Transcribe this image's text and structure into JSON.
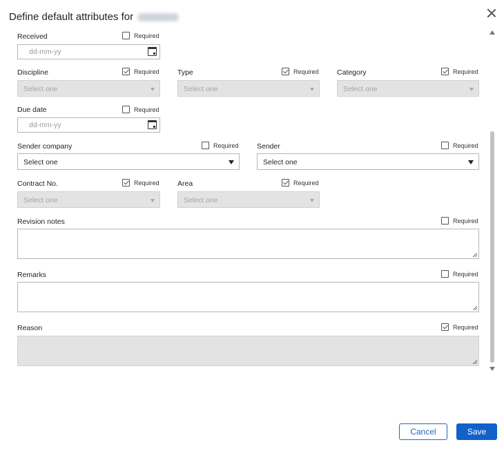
{
  "dialog": {
    "title": "Define default attributes for",
    "close_icon": "close-icon"
  },
  "required_label": "Required",
  "fields": {
    "received": {
      "label": "Received",
      "placeholder": "dd-mm-yy",
      "required": false
    },
    "discipline": {
      "label": "Discipline",
      "value": "Select one",
      "required": true,
      "disabled": true
    },
    "type": {
      "label": "Type",
      "value": "Select one",
      "required": true,
      "disabled": true
    },
    "category": {
      "label": "Category",
      "value": "Select one",
      "required": true,
      "disabled": true
    },
    "due_date": {
      "label": "Due date",
      "placeholder": "dd-mm-yy",
      "required": false
    },
    "sender_company": {
      "label": "Sender company",
      "value": "Select one",
      "required": false
    },
    "sender": {
      "label": "Sender",
      "value": "Select one",
      "required": false
    },
    "contract_no": {
      "label": "Contract No.",
      "value": "Select one",
      "required": true,
      "disabled": true
    },
    "area": {
      "label": "Area",
      "value": "Select one",
      "required": true,
      "disabled": true
    },
    "revision_notes": {
      "label": "Revision notes",
      "required": false
    },
    "remarks": {
      "label": "Remarks",
      "required": false
    },
    "reason": {
      "label": "Reason",
      "required": true,
      "disabled": true
    }
  },
  "buttons": {
    "cancel": "Cancel",
    "save": "Save"
  },
  "colors": {
    "primary": "#1261c9",
    "disabled_bg": "#e3e3e3"
  }
}
